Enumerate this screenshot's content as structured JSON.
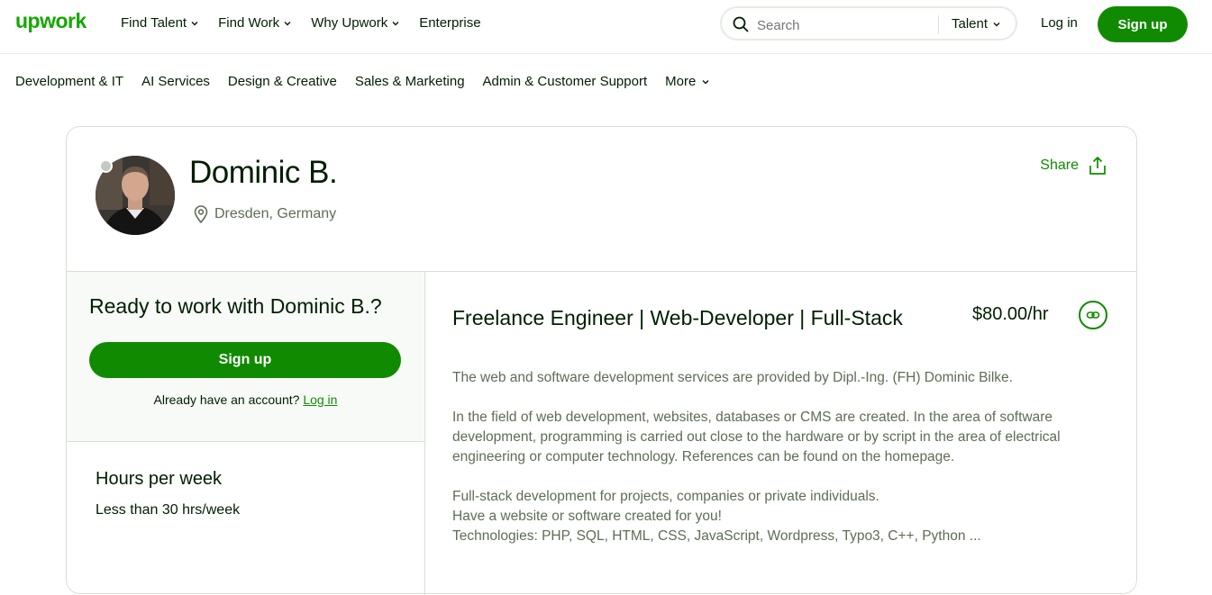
{
  "header": {
    "logo": "upwork",
    "nav": [
      {
        "label": "Find Talent",
        "dropdown": true
      },
      {
        "label": "Find Work",
        "dropdown": true
      },
      {
        "label": "Why Upwork",
        "dropdown": true
      },
      {
        "label": "Enterprise",
        "dropdown": false
      }
    ],
    "search": {
      "placeholder": "Search",
      "scope": "Talent"
    },
    "login": "Log in",
    "signup": "Sign up"
  },
  "categories": [
    "Development & IT",
    "AI Services",
    "Design & Creative",
    "Sales & Marketing",
    "Admin & Customer Support",
    "More"
  ],
  "profile": {
    "name": "Dominic B.",
    "location": "Dresden, Germany",
    "share": "Share"
  },
  "cta": {
    "title": "Ready to work with Dominic B.?",
    "signup": "Sign up",
    "already": "Already have an account?",
    "login": "Log in"
  },
  "hours": {
    "title": "Hours per week",
    "value": "Less than 30 hrs/week"
  },
  "job": {
    "title": "Freelance Engineer | Web-Developer | Full-Stack",
    "rate": "$80.00/hr",
    "paragraphs": [
      "The web and software development services are provided by Dipl.-Ing. (FH) Dominic Bilke.",
      "In the field of web development, websites, databases or CMS are created. In the area of software development, programming is carried out close to the hardware or by script in the area of electrical engineering or computer technology. References can be found on the homepage.",
      "Full-stack development for projects, companies or private individuals.",
      "Have a website or software created for you!",
      "Technologies: PHP, SQL, HTML, CSS, JavaScript, Wordpress, Typo3, C++, Python ..."
    ]
  },
  "colors": {
    "brand": "#14a800",
    "button": "#108a00",
    "text": "#001e00",
    "muted": "#5e6d55"
  }
}
